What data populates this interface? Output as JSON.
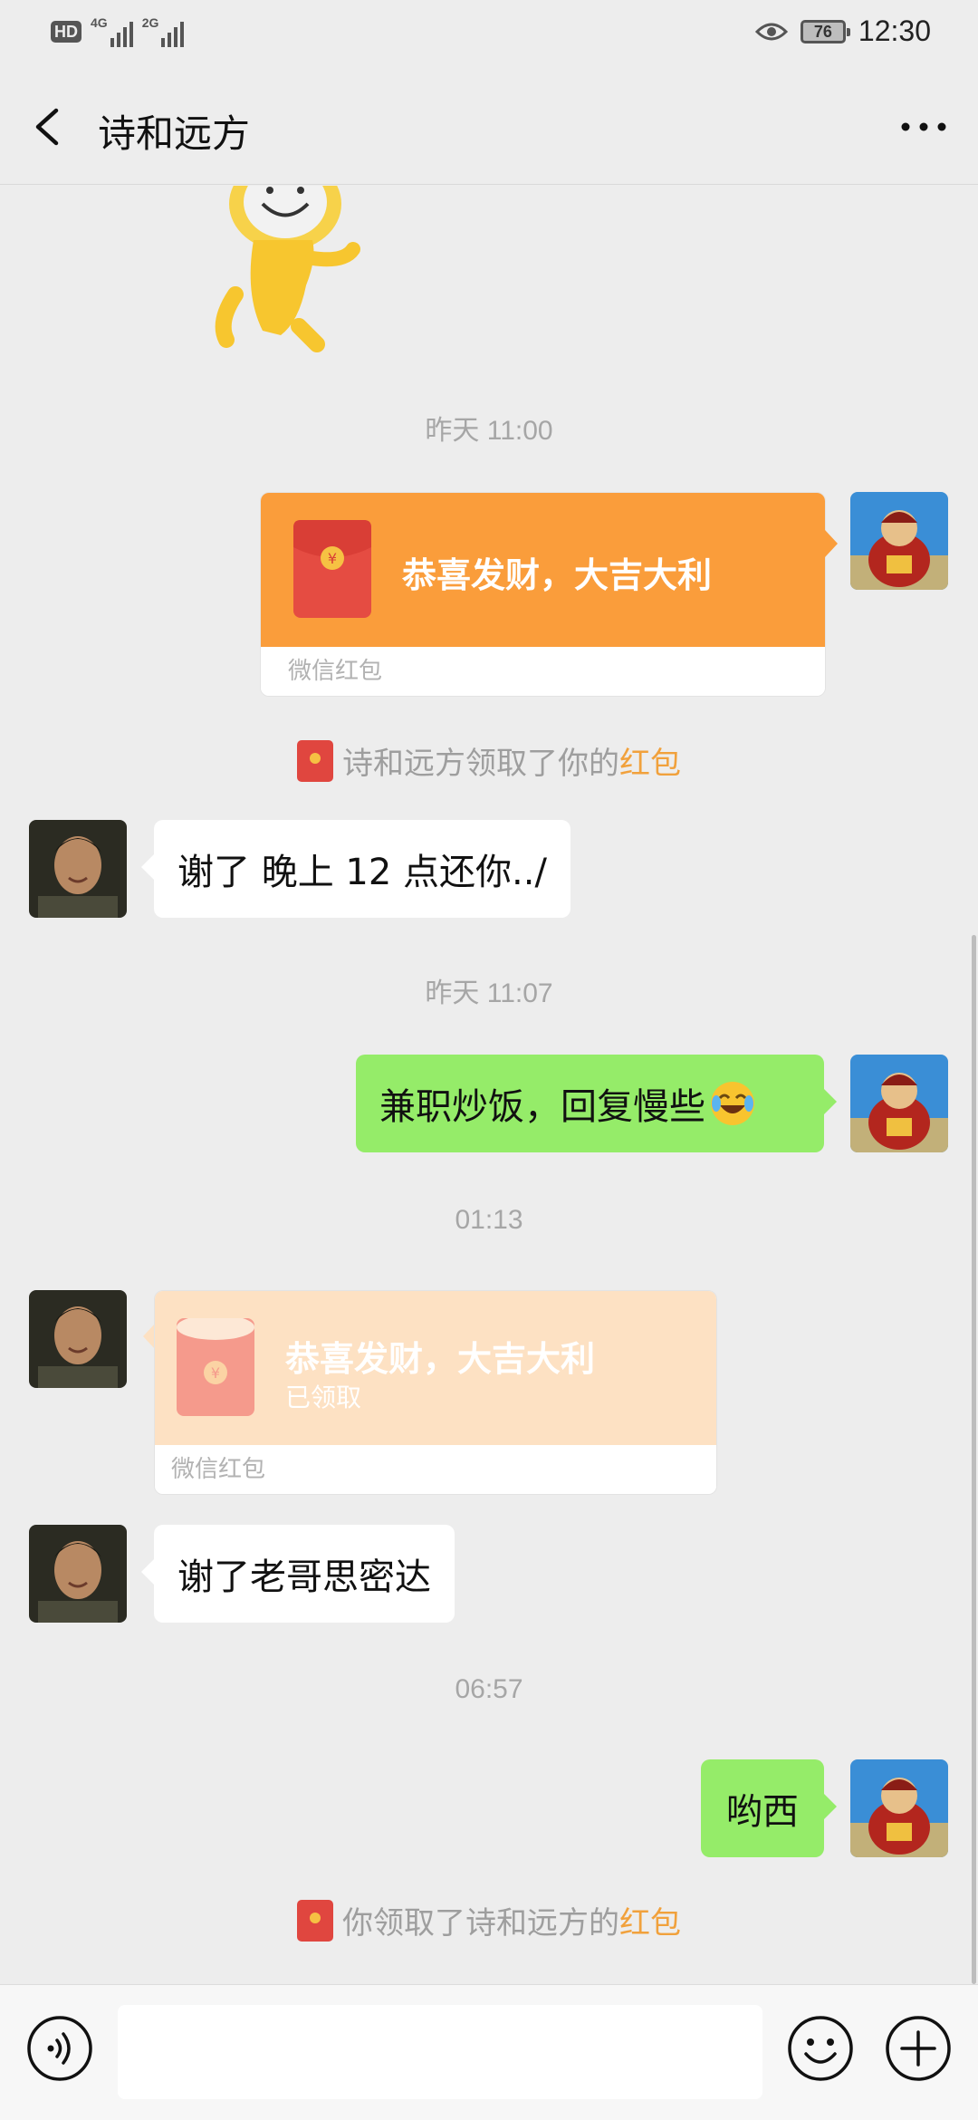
{
  "status_bar": {
    "hd_label": "HD",
    "sim1_label": "4G",
    "sim2_label": "2G",
    "battery": "76",
    "time": "12:30"
  },
  "header": {
    "title": "诗和远方"
  },
  "messages": {
    "m1_time": "昨天 11:00",
    "m2_packet_title": "恭喜发财，大吉大利",
    "m2_packet_footer": "微信红包",
    "m3_notice_text": "诗和远方领取了你的",
    "m3_notice_link": "红包",
    "m4_text": "谢了   晚上 12 点还你../",
    "m5_time": "昨天 11:07",
    "m6_text": "兼职炒饭，回复慢些",
    "m7_time": "01:13",
    "m8_packet_title": "恭喜发财，大吉大利",
    "m8_packet_status": "已领取",
    "m8_packet_footer": "微信红包",
    "m9_text": "谢了老哥思密达",
    "m10_time": "06:57",
    "m11_text": "哟西",
    "m12_notice_text": "你领取了诗和远方的",
    "m12_notice_link": "红包"
  },
  "colors": {
    "sent_bubble": "#95ec69",
    "packet_orange": "#fa9d3b",
    "packet_opened": "#fde1c3",
    "link_orange": "#f1a13c"
  }
}
